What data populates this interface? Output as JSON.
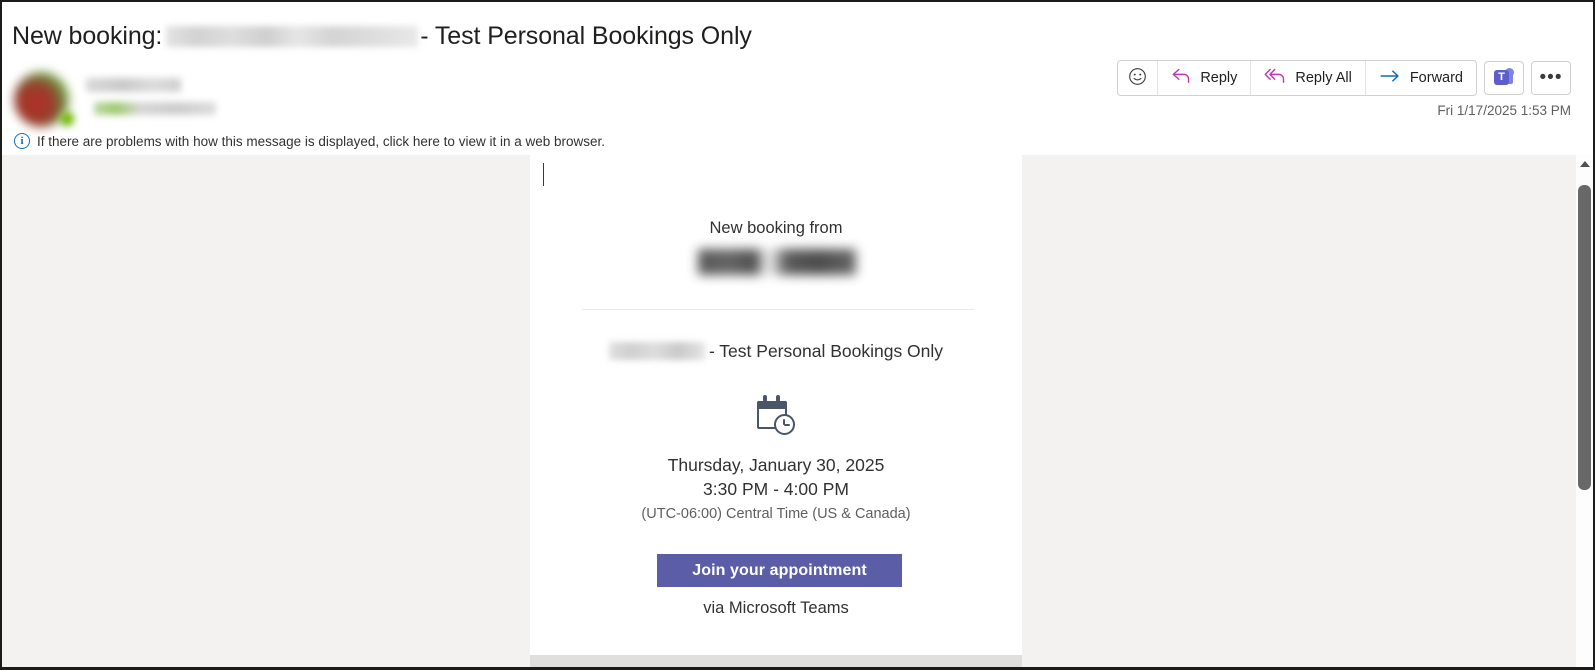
{
  "window": {
    "kind": "outlook-reading-pane"
  },
  "header": {
    "subject_prefix": "New booking:",
    "subject_suffix": "- Test Personal Bookings Only",
    "redacted_subject_middle": true,
    "timestamp": "Fri 1/17/2025 1:53 PM",
    "sender_name_redacted": true,
    "sender_address_redacted": true,
    "presence": "available"
  },
  "toolbar": {
    "react_label": "React",
    "react_icon": "smiley-icon",
    "reply_label": "Reply",
    "reply_icon": "reply-arrow-icon",
    "reply_all_label": "Reply All",
    "reply_all_icon": "reply-all-arrow-icon",
    "forward_label": "Forward",
    "forward_icon": "forward-arrow-icon",
    "teams_label": "T",
    "teams_icon": "microsoft-teams-icon",
    "more_label": "•••",
    "more_icon": "ellipsis-icon",
    "colors": {
      "reply_accent": "#c239b3",
      "forward_accent": "#0f6cbd",
      "teams_accent": "#5b5fc7"
    }
  },
  "infobar": {
    "icon": "info-circle-icon",
    "text": "If there are problems with how this message is displayed, click here to view it in a web browser."
  },
  "email_body": {
    "from_heading": "New booking from",
    "booker_name_redacted": true,
    "service_name_redacted": true,
    "service_title": "- Test Personal Bookings Only",
    "calendar_icon": "calendar-clock-icon",
    "date": "Thursday, January 30, 2025",
    "time_range": "3:30 PM - 4:00 PM",
    "timezone": "(UTC-06:00) Central Time (US & Canada)",
    "join_button_label": "Join your appointment",
    "join_button_color": "#5b5ea6",
    "via_label": "via Microsoft Teams"
  },
  "scrollbar": {
    "up_arrow": "scroll-up-arrow-icon",
    "thumb": "scroll-thumb"
  }
}
